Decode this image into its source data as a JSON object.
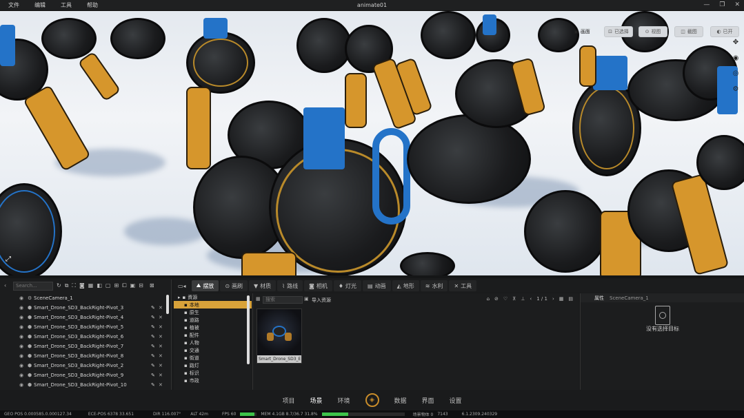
{
  "window": {
    "title": "animate01"
  },
  "menu": [
    "文件",
    "编辑",
    "工具",
    "帮助"
  ],
  "viewport_toolbar": [
    {
      "label": "画面",
      "icon": "picture-icon"
    },
    {
      "label": "已选择",
      "icon": "select-icon"
    },
    {
      "label": "视图",
      "icon": "view-icon"
    },
    {
      "label": "截图",
      "icon": "screenshot-icon"
    },
    {
      "label": "已开",
      "icon": "toggle-icon"
    }
  ],
  "outliner": {
    "search_placeholder": "Search...",
    "items": [
      "SceneCamera_1",
      "Smart_Drone_SD3_BackRight-Pivot_3",
      "Smart_Drone_SD3_BackRight-Pivot_4",
      "Smart_Drone_SD3_BackRight-Pivot_5",
      "Smart_Drone_SD3_BackRight-Pivot_6",
      "Smart_Drone_SD3_BackRight-Pivot_7",
      "Smart_Drone_SD3_BackRight-Pivot_8",
      "Smart_Drone_SD3_BackRight-Pivot_2",
      "Smart_Drone_SD3_BackRight-Pivot_9",
      "Smart_Drone_SD3_BackRight-Pivot_10"
    ]
  },
  "tabs": [
    "摆放",
    "画刷",
    "材质",
    "路线",
    "相机",
    "灯光",
    "动画",
    "地形",
    "水利",
    "工具"
  ],
  "active_tab": "摆放",
  "categories": [
    "資源",
    "本地",
    "原生",
    "道路",
    "植被",
    "配件",
    "人物",
    "交通",
    "街道",
    "路灯",
    "标识",
    "市政"
  ],
  "selected_category": "本地",
  "asset_browser": {
    "search_placeholder": "搜索",
    "import_label": "导入资源",
    "page": "1 / 1",
    "assets": [
      {
        "label": "Smart_Drone_SD3_E"
      }
    ]
  },
  "properties": {
    "title": "属性",
    "object": "SceneCamera_1",
    "empty_text": "没有选择目标"
  },
  "bottom_nav": [
    "项目",
    "场景",
    "环境",
    "数据",
    "界面",
    "设置"
  ],
  "active_nav": "场景",
  "status": {
    "geo_pos": "GEO POS  0.000585.0.000127.34",
    "ece_pos": "ECE-POS  6378 33.651",
    "dir": "DIR  116.007°",
    "alt": "ALT  42m",
    "fps": "FPS  60",
    "mem": "MEM  4.1GB 8.7/36.7 31.8%",
    "objects": "场景物体 0",
    "frame": "7143",
    "version": "6.1.2309.240329",
    "fps_level": 0.85,
    "mem_level": 0.32
  },
  "colors": {
    "accent": "#d8a23a",
    "drone_blue": "#2473c8",
    "drone_orange": "#d6962c"
  }
}
